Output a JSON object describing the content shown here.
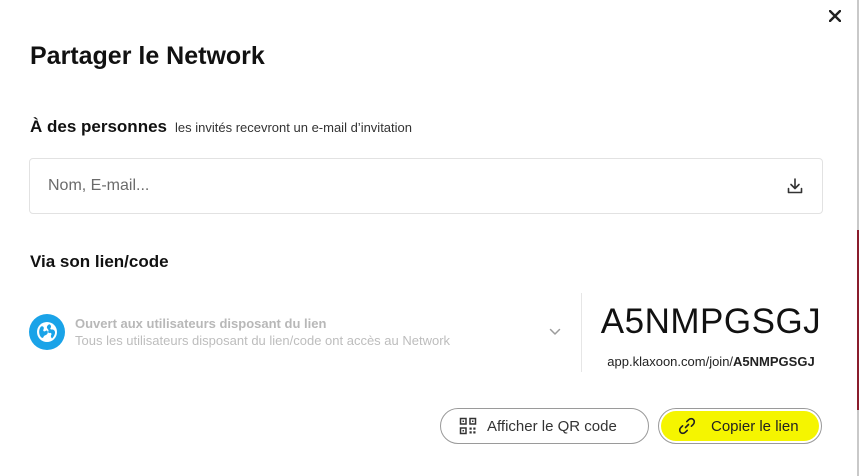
{
  "dialog": {
    "title": "Partager le Network",
    "close_icon": "close-icon"
  },
  "people": {
    "heading": "À des personnes",
    "subtext": "les invités recevront un e-mail d’invitation",
    "input_placeholder": "Nom, E-mail...",
    "input_value": "",
    "import_icon": "download-icon"
  },
  "link_section": {
    "heading": "Via son lien/code",
    "access": {
      "icon": "globe-icon",
      "title": "Ouvert aux utilisateurs disposant du lien",
      "description": "Tous les utilisateurs disposant du lien/code ont accès au Network",
      "chevron_icon": "chevron-down-icon"
    },
    "code": "A5NMPGSGJ",
    "url_prefix": "app.klaxoon.com/join/",
    "url_code": "A5NMPGSGJ"
  },
  "actions": {
    "qr_label": "Afficher le QR code",
    "qr_icon": "qr-code-icon",
    "copy_label": "Copier le lien",
    "copy_icon": "link-icon"
  },
  "colors": {
    "accent_blue": "#1aa3e8",
    "highlight_yellow": "#f5f500",
    "edge_accent": "#8a1d2c"
  }
}
